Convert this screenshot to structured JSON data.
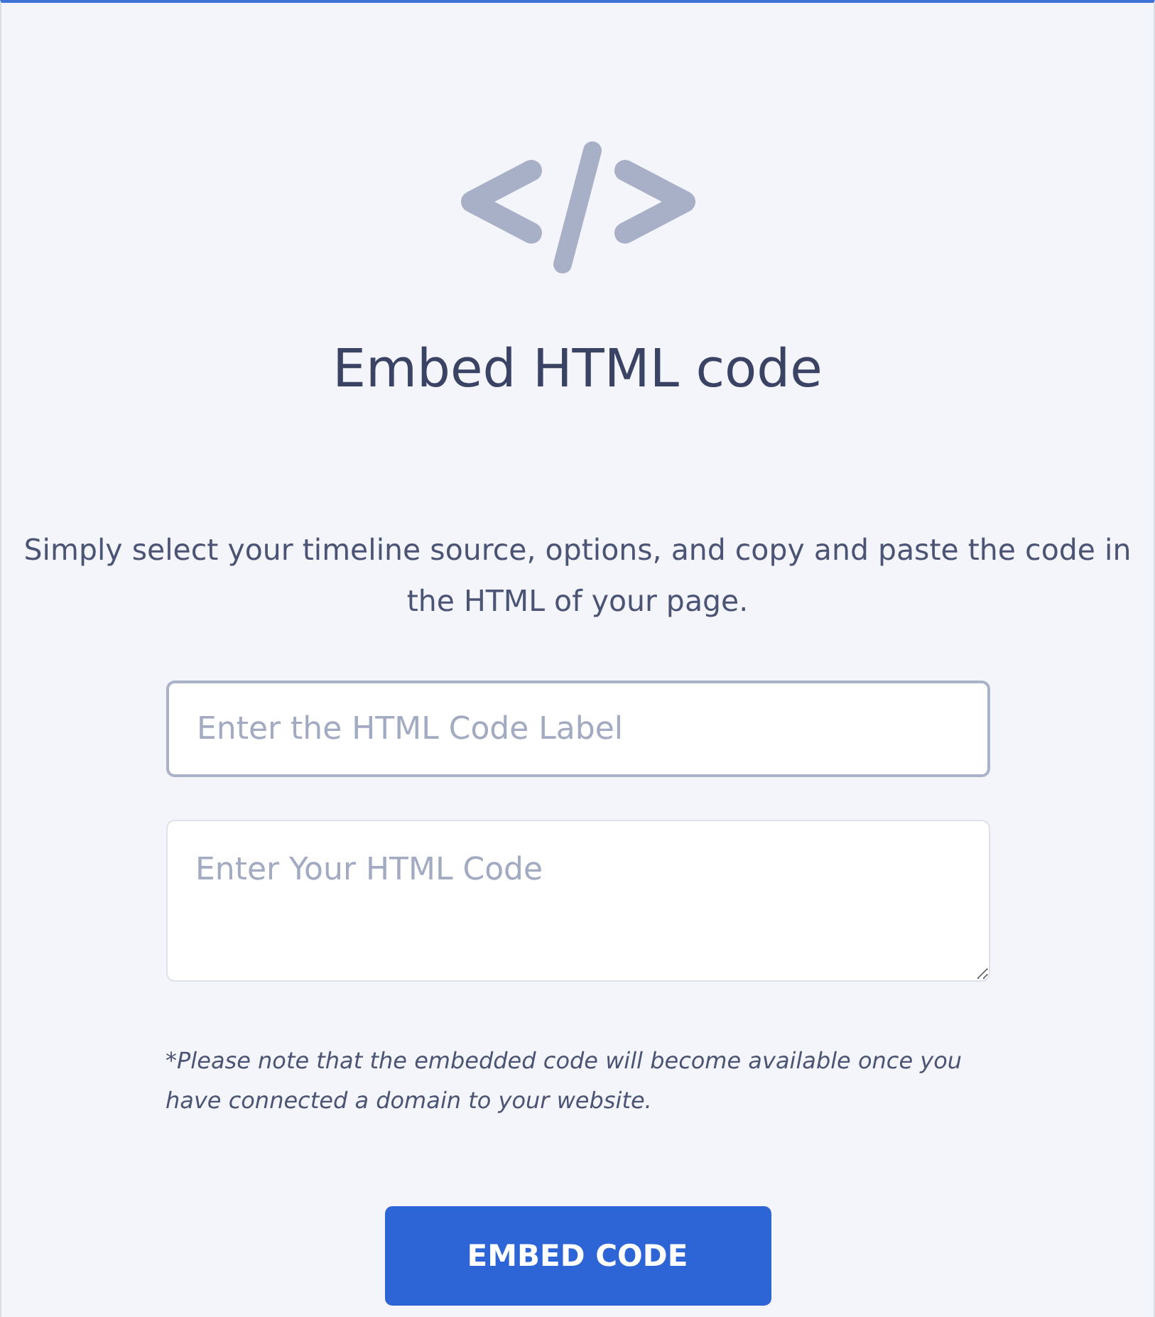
{
  "title": "Embed HTML code",
  "description": "Simply select your timeline source, options, and copy and paste the code in the HTML of your page.",
  "label_field": {
    "placeholder": "Enter the HTML Code Label",
    "focused": true
  },
  "code_field": {
    "placeholder": "Enter Your HTML Code",
    "focused": false
  },
  "note": "*Please note that the embedded code will become available once you have connected a domain to your website.",
  "button": "EMBED CODE"
}
